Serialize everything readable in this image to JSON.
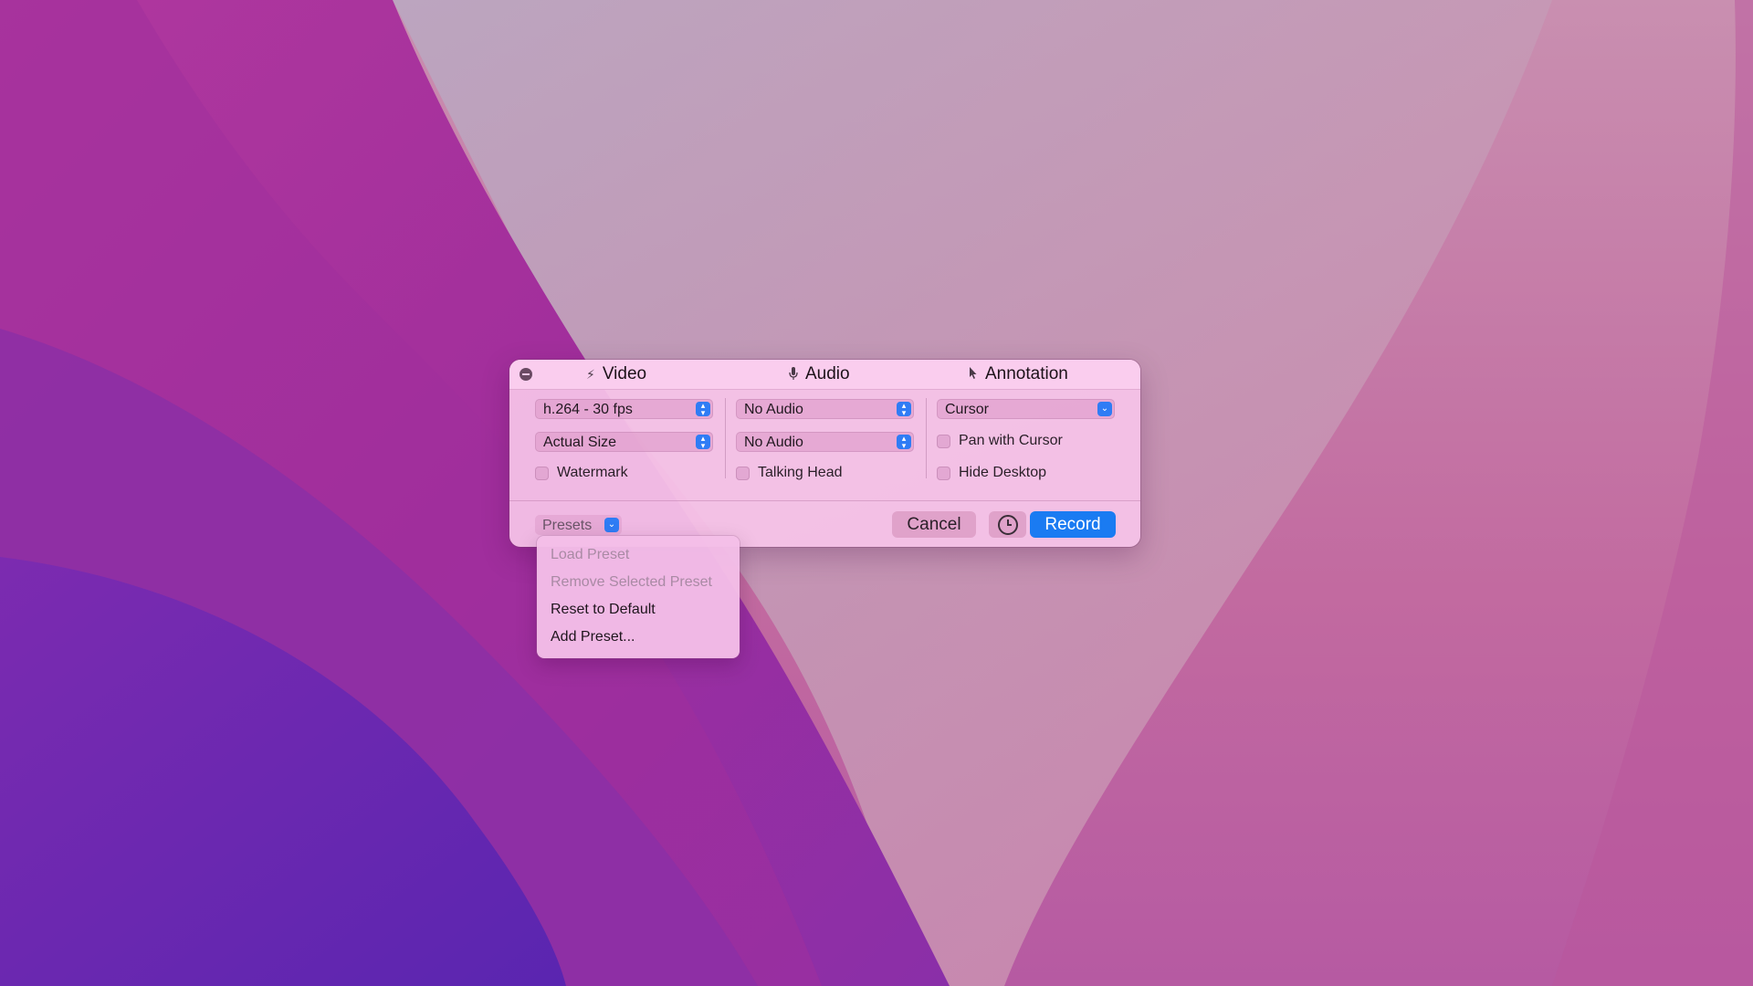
{
  "panel": {
    "sections": [
      {
        "title": "Video",
        "icon": "lightning-icon"
      },
      {
        "title": "Audio",
        "icon": "microphone-icon"
      },
      {
        "title": "Annotation",
        "icon": "cursor-arrow-icon"
      }
    ],
    "video": {
      "codec": "h.264 - 30 fps",
      "size": "Actual Size",
      "watermark_label": "Watermark"
    },
    "audio": {
      "source_1": "No Audio",
      "source_2": "No Audio",
      "talking_head_label": "Talking Head"
    },
    "annotation": {
      "mode": "Cursor",
      "pan_label": "Pan with Cursor",
      "hide_desktop_label": "Hide Desktop"
    },
    "footer": {
      "presets_label": "Presets",
      "cancel_label": "Cancel",
      "timer_icon": "clock-icon",
      "record_label": "Record"
    }
  },
  "presets_menu": {
    "items": [
      {
        "label": "Load Preset",
        "enabled": false
      },
      {
        "label": "Remove Selected Preset",
        "enabled": false
      },
      {
        "label": "Reset to Default",
        "enabled": true
      },
      {
        "label": "Add Preset...",
        "enabled": true
      }
    ]
  },
  "colors": {
    "accent": "#1a7bf2",
    "panel_bg": "#f6c4e8",
    "disabled_text": "#a98aa4"
  }
}
